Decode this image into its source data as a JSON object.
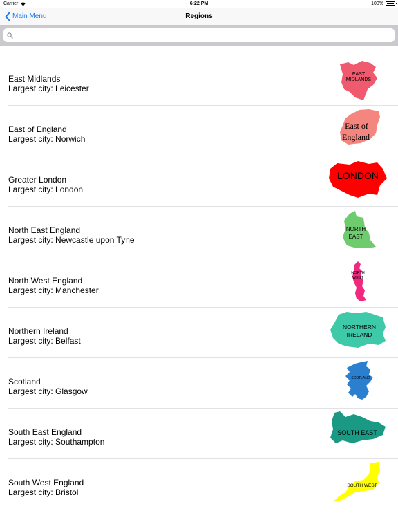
{
  "status_bar": {
    "carrier": "Carrier",
    "time": "6:22 PM",
    "battery": "100%"
  },
  "navbar": {
    "back_label": "Main Menu",
    "title": "Regions"
  },
  "search": {
    "placeholder": "",
    "value": ""
  },
  "regions": [
    {
      "name": "East Midlands",
      "city": "Largest city: Leicester",
      "map_label": [
        "EAST",
        "MIDLANDS"
      ],
      "color": "#f05a6e"
    },
    {
      "name": "East of England",
      "city": "Largest city: Norwich",
      "map_label": [
        "East of",
        "England"
      ],
      "color": "#f4857f"
    },
    {
      "name": "Greater London",
      "city": "Largest city: London",
      "map_label": [
        "LONDON"
      ],
      "color": "#ff0000"
    },
    {
      "name": "North East England",
      "city": "Largest city: Newcastle upon Tyne",
      "map_label": [
        "NORTH",
        "EAST"
      ],
      "color": "#6ecb6e"
    },
    {
      "name": "North West England",
      "city": "Largest city: Manchester",
      "map_label": [
        "NORTH",
        "WEST"
      ],
      "color": "#f0287f"
    },
    {
      "name": "Northern Ireland",
      "city": "Largest city: Belfast",
      "map_label": [
        "NORTHERN",
        "IRELAND"
      ],
      "color": "#3ec9a9"
    },
    {
      "name": "Scotland",
      "city": "Largest city: Glasgow",
      "map_label": [
        "SCOTLAND"
      ],
      "color": "#2b7fcf"
    },
    {
      "name": "South East England",
      "city": "Largest city: Southampton",
      "map_label": [
        "SOUTH EAST"
      ],
      "color": "#1a9a84"
    },
    {
      "name": "South West England",
      "city": "Largest city: Bristol",
      "map_label": [
        "SOUTH WEST"
      ],
      "color": "#ffff00"
    }
  ]
}
